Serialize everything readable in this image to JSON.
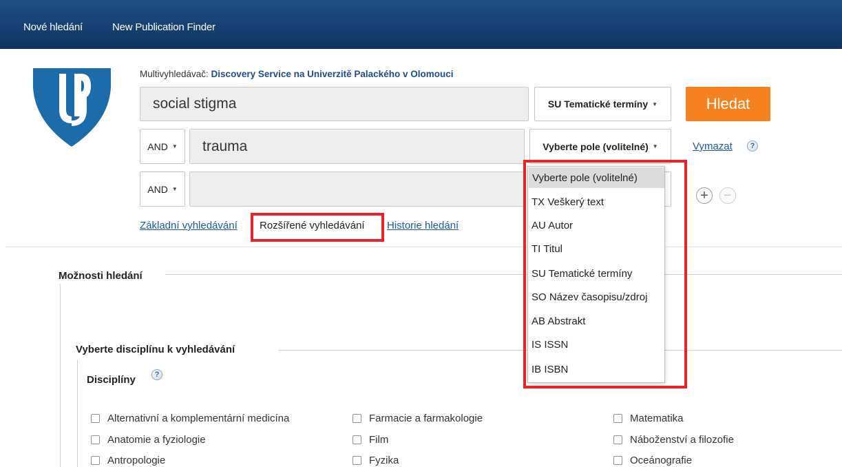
{
  "topbar": {
    "new_search": "Nové hledání",
    "publication_finder": "New Publication Finder"
  },
  "database": {
    "prefix": "Multivyhledávač: ",
    "name": "Discovery Service na Univerzitě Palackého v Olomouci"
  },
  "search": {
    "rows": [
      {
        "bool": "",
        "term": "social stigma",
        "field": "SU Tematické termíny"
      },
      {
        "bool": "AND",
        "term": "trauma",
        "field": "Vyberte pole (volitelné)"
      },
      {
        "bool": "AND",
        "term": "",
        "field": ""
      }
    ],
    "search_button": "Hledat",
    "clear_link": "Vymazat",
    "help_glyph": "?"
  },
  "mode_links": {
    "basic": "Základní vyhledávání",
    "advanced": "Rozšířené vyhledávání",
    "history": "Historie hledání"
  },
  "field_menu": {
    "options": [
      "Vyberte pole (volitelné)",
      "TX Veškerý text",
      "AU Autor",
      "TI Titul",
      "SU Tematické termíny",
      "SO Název časopisu/zdroj",
      "AB Abstrakt",
      "IS ISSN",
      "IB ISBN"
    ],
    "selected_index": 0
  },
  "options_section": {
    "title": "Možnosti hledání",
    "discipline_title": "Vyberte disciplínu k vyhledávání",
    "disciplines_label": "Disciplíny",
    "disciplines": [
      [
        "Alternativní a komplementární medicína",
        "Farmacie a farmakologie",
        "Matematika"
      ],
      [
        "Anatomie a fyziologie",
        "Film",
        "Náboženství a filozofie"
      ],
      [
        "Antropologie",
        "Fyzika",
        "Oceánografie"
      ]
    ]
  },
  "colors": {
    "topbar": "#1d4f86",
    "accent_orange": "#f58220",
    "link_blue": "#1a5aa8",
    "highlight_red": "#e8232a",
    "logo_blue": "#1c6cab"
  }
}
